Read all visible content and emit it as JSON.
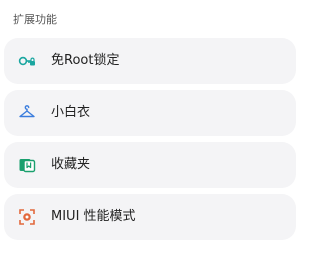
{
  "section": {
    "title": "扩展功能"
  },
  "items": [
    {
      "label": "免Root锁定",
      "icon": "key-lock-icon",
      "color": "#1aa6a0"
    },
    {
      "label": "小白衣",
      "icon": "hanger-icon",
      "color": "#3b7ddd"
    },
    {
      "label": "收藏夹",
      "icon": "bookmark-folder-icon",
      "color": "#1aa06e"
    },
    {
      "label": "MIUI 性能模式",
      "icon": "performance-mode-icon",
      "color": "#e2683c"
    }
  ]
}
